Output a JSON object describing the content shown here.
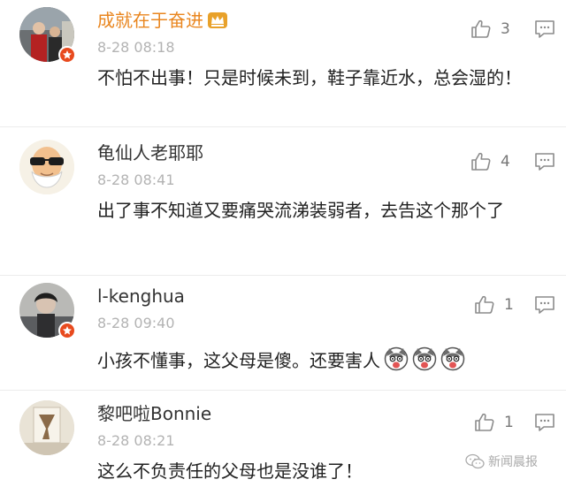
{
  "comments": [
    {
      "username": "成就在于奋进",
      "time": "8-28 08:18",
      "likes": "3",
      "text": "不怕不出事！只是时候未到，鞋子靠近水，总会湿的！",
      "has_crown": true,
      "verified": true
    },
    {
      "username": "龟仙人老耶耶",
      "time": "8-28 08:41",
      "likes": "4",
      "text": "出了事不知道又要痛哭流涕装弱者，去告这个那个了",
      "verified": false
    },
    {
      "username": "l-kenghua",
      "time": "8-28 09:40",
      "likes": "1",
      "text": "小孩不懂事，这父母是傻。还要害人",
      "emoji_count": 3,
      "verified": true
    },
    {
      "username": "黎吧啦Bonnie",
      "time": "8-28 08:21",
      "likes": "1",
      "text": "这么不负责任的父母也是没谁了！",
      "verified": false
    }
  ],
  "watermark": "新闻晨报",
  "icons": {
    "like": "thumbs-up-icon",
    "reply": "comment-bubble-icon",
    "verified": "verified-badge-icon",
    "crown": "crown-icon",
    "emoji": "husky-emoji-icon"
  },
  "colors": {
    "username_vip": "#e9861f",
    "time": "#b3b3b3",
    "badge": "#e84a1e"
  }
}
